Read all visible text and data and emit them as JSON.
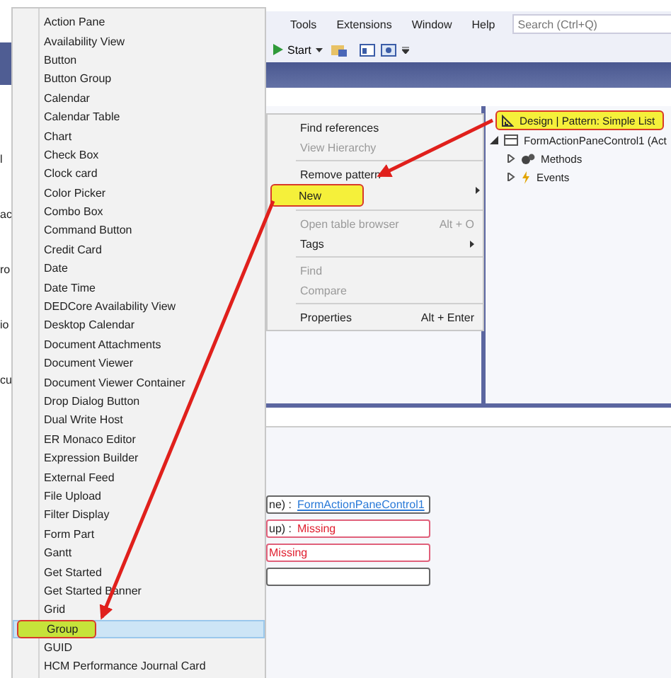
{
  "menu_bar": {
    "items": [
      "Tools",
      "Extensions",
      "Window",
      "Help"
    ],
    "search": {
      "placeholder": "Search (Ctrl+Q)"
    }
  },
  "toolbar": {
    "start_label": "Start"
  },
  "left_fragments": [
    "l",
    "ac",
    "ro",
    "io",
    "cu"
  ],
  "designer_tree": [
    {
      "label": "Design | Pattern: Simple List",
      "callout": true,
      "kind": "design"
    },
    {
      "label": "FormActionPaneControl1 (Act",
      "callout": false,
      "kind": "pane",
      "expanded": true,
      "children": [
        {
          "label": "Methods",
          "callout": false,
          "kind": "methods",
          "expanded": false
        },
        {
          "label": "Events",
          "callout": false,
          "kind": "events",
          "expanded": false
        }
      ]
    }
  ],
  "context_menu": [
    {
      "kind": "item",
      "label": "Find references",
      "disabled": false,
      "callout": false
    },
    {
      "kind": "item",
      "label": "View Hierarchy",
      "disabled": true,
      "callout": false
    },
    {
      "kind": "separator"
    },
    {
      "kind": "item",
      "label": "Remove pattern",
      "disabled": false,
      "callout": false
    },
    {
      "kind": "submenu",
      "label": "New",
      "disabled": false,
      "callout": true
    },
    {
      "kind": "separator"
    },
    {
      "kind": "item",
      "label": "Open table browser",
      "shortcut": "Alt + O",
      "disabled": true,
      "callout": false
    },
    {
      "kind": "submenu",
      "label": "Tags",
      "disabled": false,
      "callout": false
    },
    {
      "kind": "separator"
    },
    {
      "kind": "item",
      "label": "Find",
      "disabled": true,
      "callout": false
    },
    {
      "kind": "item",
      "label": "Compare",
      "disabled": true,
      "callout": false
    },
    {
      "kind": "separator"
    },
    {
      "kind": "item",
      "label": "Properties",
      "shortcut": "Alt + Enter",
      "disabled": false,
      "callout": false
    }
  ],
  "new_submenu": [
    {
      "label": "Action Pane",
      "selected": false,
      "callout": false
    },
    {
      "label": "Availability View",
      "selected": false,
      "callout": false
    },
    {
      "label": "Button",
      "selected": false,
      "callout": false
    },
    {
      "label": "Button Group",
      "selected": false,
      "callout": false
    },
    {
      "label": "Calendar",
      "selected": false,
      "callout": false
    },
    {
      "label": "Calendar Table",
      "selected": false,
      "callout": false
    },
    {
      "label": "Chart",
      "selected": false,
      "callout": false
    },
    {
      "label": "Check Box",
      "selected": false,
      "callout": false
    },
    {
      "label": "Clock card",
      "selected": false,
      "callout": false
    },
    {
      "label": "Color Picker",
      "selected": false,
      "callout": false
    },
    {
      "label": "Combo Box",
      "selected": false,
      "callout": false
    },
    {
      "label": "Command Button",
      "selected": false,
      "callout": false
    },
    {
      "label": "Credit Card",
      "selected": false,
      "callout": false
    },
    {
      "label": "Date",
      "selected": false,
      "callout": false
    },
    {
      "label": "Date Time",
      "selected": false,
      "callout": false
    },
    {
      "label": "DEDCore Availability View",
      "selected": false,
      "callout": false
    },
    {
      "label": "Desktop Calendar",
      "selected": false,
      "callout": false
    },
    {
      "label": "Document Attachments",
      "selected": false,
      "callout": false
    },
    {
      "label": "Document Viewer",
      "selected": false,
      "callout": false
    },
    {
      "label": "Document Viewer Container",
      "selected": false,
      "callout": false
    },
    {
      "label": "Drop Dialog Button",
      "selected": false,
      "callout": false
    },
    {
      "label": "Dual Write Host",
      "selected": false,
      "callout": false
    },
    {
      "label": "ER Monaco Editor",
      "selected": false,
      "callout": false
    },
    {
      "label": "Expression Builder",
      "selected": false,
      "callout": false
    },
    {
      "label": "External Feed",
      "selected": false,
      "callout": false
    },
    {
      "label": "File Upload",
      "selected": false,
      "callout": false
    },
    {
      "label": "Filter Display",
      "selected": false,
      "callout": false
    },
    {
      "label": "Form Part",
      "selected": false,
      "callout": false
    },
    {
      "label": "Gantt",
      "selected": false,
      "callout": false
    },
    {
      "label": "Get Started",
      "selected": false,
      "callout": false
    },
    {
      "label": "Get Started Banner",
      "selected": false,
      "callout": false
    },
    {
      "label": "Grid",
      "selected": false,
      "callout": false
    },
    {
      "label": "Group",
      "selected": true,
      "callout": true
    },
    {
      "label": "GUID",
      "selected": false,
      "callout": false
    },
    {
      "label": "HCM Performance Journal Card",
      "selected": false,
      "callout": false
    }
  ],
  "pattern_fields": [
    {
      "label": "ne) :",
      "value": "FormActionPaneControl1",
      "kind": "link"
    },
    {
      "label": "up) :",
      "value": "Missing",
      "kind": "missing"
    },
    {
      "value": "Missing",
      "kind": "missing"
    },
    {
      "kind": "empty"
    }
  ]
}
